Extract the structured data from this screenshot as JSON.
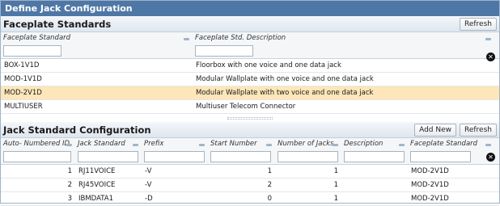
{
  "window": {
    "title": "Define Jack Configuration"
  },
  "faceplate": {
    "title": "Faceplate Standards",
    "refresh_label": "Refresh",
    "columns": [
      "Faceplate Standard",
      "Faceplate Std. Description"
    ],
    "rows": [
      {
        "standard": "BOX-1V1D",
        "description": "Floorbox with one voice and one data jack",
        "selected": false
      },
      {
        "standard": "MOD-1V1D",
        "description": "Modular Wallplate with one voice and one data jack",
        "selected": false
      },
      {
        "standard": "MOD-2V1D",
        "description": "Modular Wallplate with two voice and one data jack",
        "selected": true
      },
      {
        "standard": "MULTIUSER",
        "description": "Multiuser Telecom Connector",
        "selected": false
      }
    ]
  },
  "jack": {
    "title": "Jack Standard Configuration",
    "add_new_label": "Add New",
    "refresh_label": "Refresh",
    "columns": [
      "Auto- Numbered ID",
      "Jack Standard",
      "Prefix",
      "Start Number",
      "Number of Jacks",
      "Description",
      "Faceplate Standard"
    ],
    "rows": [
      {
        "id": "1",
        "standard": "RJ11VOICE",
        "prefix": "-V",
        "start": "1",
        "count": "1",
        "description": "",
        "faceplate": "MOD-2V1D"
      },
      {
        "id": "2",
        "standard": "RJ45VOICE",
        "prefix": "-V",
        "start": "2",
        "count": "1",
        "description": "",
        "faceplate": "MOD-2V1D"
      },
      {
        "id": "3",
        "standard": "IBMDATA1",
        "prefix": "-D",
        "start": "0",
        "count": "1",
        "description": "",
        "faceplate": "MOD-2V1D"
      }
    ]
  }
}
